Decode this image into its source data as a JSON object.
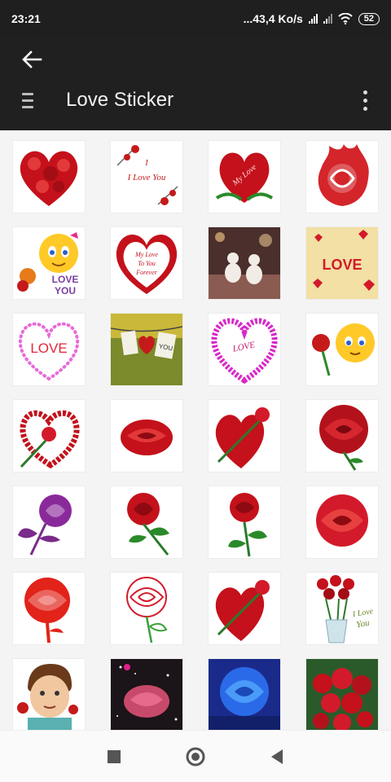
{
  "status_bar": {
    "time": "23:21",
    "network_speed": "...43,4 Ko/s",
    "battery": "52",
    "icons": [
      "signal-icon",
      "signal-icon",
      "wifi-icon",
      "battery-icon"
    ]
  },
  "app_bar": {
    "title": "Love Sticker",
    "back_icon": "arrow-back-icon",
    "menu_icon": "drawer-menu-icon",
    "more_icon": "more-vert-icon"
  },
  "stickers": [
    {
      "motif": "rose-heart"
    },
    {
      "motif": "i-love-you-card",
      "caption": "I Love You"
    },
    {
      "motif": "heart-my-love",
      "caption": "My Love"
    },
    {
      "motif": "flame-rose"
    },
    {
      "motif": "emoji-love-you",
      "caption": "LOVE YOU"
    },
    {
      "motif": "heart-frame-text",
      "caption": "My Love To You Forever"
    },
    {
      "motif": "snowmen-photo"
    },
    {
      "motif": "love-hearts-card",
      "caption": "LOVE"
    },
    {
      "motif": "pearl-heart",
      "caption": "LOVE"
    },
    {
      "motif": "clothesline-photo",
      "caption": "YOU"
    },
    {
      "motif": "flower-heart",
      "caption": "LOVE"
    },
    {
      "motif": "emoji-rose"
    },
    {
      "motif": "rose-ring-heart"
    },
    {
      "motif": "red-rose"
    },
    {
      "motif": "rose-petal-heart"
    },
    {
      "motif": "large-red-rose"
    },
    {
      "motif": "purple-rose"
    },
    {
      "motif": "red-rose-leaves"
    },
    {
      "motif": "rose-stem"
    },
    {
      "motif": "red-rose-bloom"
    },
    {
      "motif": "red-rose-silhouette"
    },
    {
      "motif": "rose-outline"
    },
    {
      "motif": "rose-petal-heart"
    },
    {
      "motif": "rose-vase",
      "caption": "I Love You"
    },
    {
      "motif": "boy-with-rose"
    },
    {
      "motif": "glitter-rose"
    },
    {
      "motif": "blue-rose"
    },
    {
      "motif": "rose-bouquet"
    }
  ],
  "nav_bar": {
    "buttons": [
      "recents-square-icon",
      "home-circle-icon",
      "back-triangle-icon"
    ]
  },
  "colors": {
    "status_bar": "#1f1f1f",
    "app_bar": "#202020",
    "background": "#f4f4f4",
    "accent_red": "#d0101a"
  }
}
